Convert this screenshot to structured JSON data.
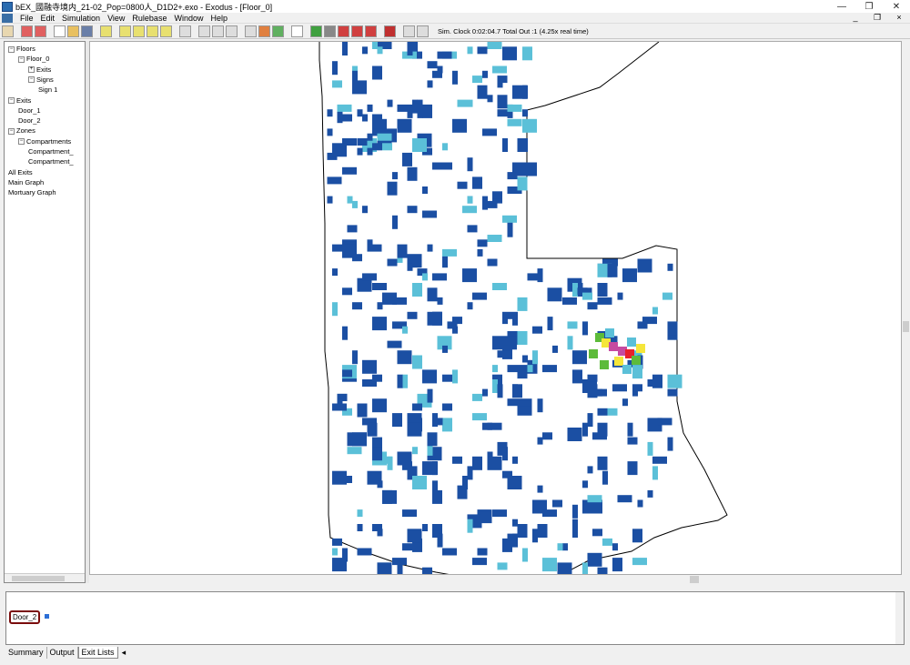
{
  "window": {
    "title": "bEX_國融寺境内_21-02_Pop=0800人_D1D2+.exo - Exodus - [Floor_0]",
    "minimize": "—",
    "restore": "❐",
    "close": "✕"
  },
  "menu": {
    "items": [
      "File",
      "Edit",
      "Simulation",
      "View",
      "Rulebase",
      "Window",
      "Help"
    ],
    "right": [
      "_",
      "❐",
      "×"
    ]
  },
  "toolbar": {
    "sim_clock": "Sim. Clock  0:02:04.7 Total Out :1   (4.25x real time)"
  },
  "tree": {
    "items": [
      {
        "label": "Floors",
        "exp": "−"
      },
      {
        "label": "Floor_0",
        "exp": "−"
      },
      {
        "label": "Exits",
        "exp": "+"
      },
      {
        "label": "Signs",
        "exp": "−"
      },
      {
        "label": "Sign 1",
        "exp": ""
      },
      {
        "label": "Exits",
        "exp": "−"
      },
      {
        "label": "Door_1",
        "exp": ""
      },
      {
        "label": "Door_2",
        "exp": ""
      },
      {
        "label": "Zones",
        "exp": "−"
      },
      {
        "label": "Compartments",
        "exp": "−"
      },
      {
        "label": "Compartment_",
        "exp": ""
      },
      {
        "label": "Compartment_",
        "exp": ""
      },
      {
        "label": "All Exits",
        "exp": ""
      },
      {
        "label": "Main Graph",
        "exp": ""
      },
      {
        "label": "Mortuary Graph",
        "exp": ""
      }
    ]
  },
  "exit_list": {
    "door_label": "Door_2"
  },
  "tabs": [
    "Summary",
    "Output",
    "Exit Lists"
  ],
  "colors": {
    "occupied": "#1b4fa3",
    "light": "#5bc0d8",
    "green": "#5dbb3a",
    "yellow": "#f5e63a",
    "magenta": "#c64aa0",
    "red": "#e8202a"
  }
}
